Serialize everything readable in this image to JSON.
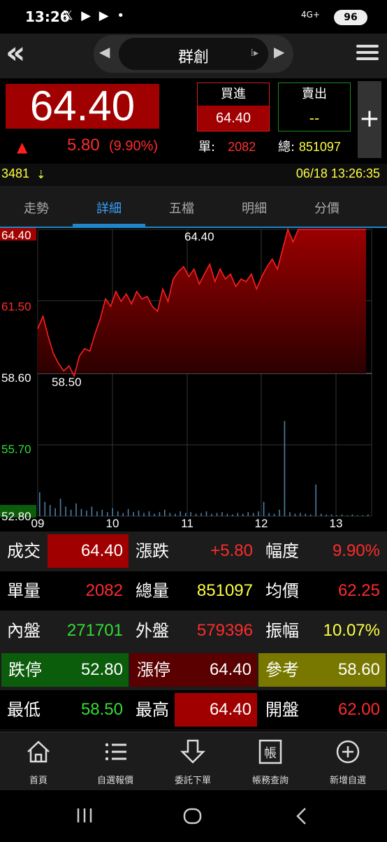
{
  "status": {
    "time": "13:26",
    "network": "4G+",
    "battery": "96",
    "apps": "𝕏 ▶ ▶ •"
  },
  "header": {
    "stock_name": "群創"
  },
  "quote": {
    "price": "64.40",
    "change": "5.80",
    "change_pct": "(9.90%)",
    "buy_label": "買進",
    "buy_value": "64.40",
    "sell_label": "賣出",
    "sell_value": "--",
    "single_label": "單:",
    "single_value": "2082",
    "total_label": "總:",
    "total_value": "851097"
  },
  "info": {
    "code": "3481",
    "datetime": "06/18 13:26:35"
  },
  "tabs": [
    "走勢",
    "詳細",
    "五檔",
    "明細",
    "分價"
  ],
  "chart_data": {
    "type": "area",
    "y_ticks": [
      "64.40",
      "61.50",
      "58.60",
      "55.70",
      "52.80"
    ],
    "x_ticks": [
      "09",
      "10",
      "11",
      "12",
      "13"
    ],
    "price_high_label": "64.40",
    "price_low_label": "58.50",
    "ylim": [
      52.8,
      64.4
    ],
    "series": [
      {
        "values": [
          60.4,
          60.9,
          60.1,
          59.4,
          59.0,
          58.7,
          58.9,
          58.5,
          59.3,
          59.6,
          59.5,
          60.2,
          60.8,
          61.6,
          61.3,
          61.9,
          61.5,
          61.8,
          61.4,
          61.9,
          61.6,
          61.7,
          61.3,
          61.1,
          62.0,
          61.5,
          62.4,
          62.7,
          62.9,
          62.5,
          62.8,
          62.2,
          62.6,
          63.0,
          62.3,
          62.8,
          62.4,
          62.6,
          62.1,
          62.4,
          62.3,
          62.6,
          62.0,
          62.5,
          62.9,
          63.2,
          62.8,
          63.6,
          64.4,
          63.9,
          64.4,
          64.4,
          64.4,
          64.4,
          64.4,
          64.4,
          64.4,
          64.4,
          64.4,
          64.4,
          64.4,
          64.4,
          64.4,
          64.4
        ]
      }
    ],
    "volume": [
      30,
      18,
      14,
      10,
      22,
      12,
      8,
      16,
      9,
      7,
      12,
      6,
      8,
      5,
      10,
      6,
      4,
      9,
      5,
      7,
      4,
      6,
      3,
      5,
      8,
      4,
      3,
      6,
      4,
      5,
      3,
      4,
      6,
      3,
      4,
      5,
      3,
      2,
      4,
      3,
      5,
      4,
      6,
      18,
      4,
      3,
      8,
      120,
      5,
      3,
      4,
      3,
      2,
      40,
      3,
      2,
      2,
      1,
      2,
      1,
      2,
      1,
      1,
      2
    ]
  },
  "stats": {
    "r1": [
      {
        "label": "成交",
        "value": "64.40"
      },
      {
        "label": "漲跌",
        "value": "+5.80"
      },
      {
        "label": "幅度",
        "value": "9.90%"
      }
    ],
    "r2": [
      {
        "label": "單量",
        "value": "2082"
      },
      {
        "label": "總量",
        "value": "851097"
      },
      {
        "label": "均價",
        "value": "62.25"
      }
    ],
    "r3": [
      {
        "label": "內盤",
        "value": "271701"
      },
      {
        "label": "外盤",
        "value": "579396"
      },
      {
        "label": "振幅",
        "value": "10.07%"
      }
    ],
    "r4": [
      {
        "label": "跌停",
        "value": "52.80"
      },
      {
        "label": "漲停",
        "value": "64.40"
      },
      {
        "label": "參考",
        "value": "58.60"
      }
    ],
    "r5": [
      {
        "label": "最低",
        "value": "58.50"
      },
      {
        "label": "最高",
        "value": "64.40"
      },
      {
        "label": "開盤",
        "value": "62.00"
      }
    ]
  },
  "bottom_nav": [
    "首頁",
    "自選報價",
    "委託下單",
    "帳務查詢",
    "新增自選"
  ],
  "colors": {
    "up": "#ff2b2b",
    "down": "#33dd33",
    "neutral": "#ffff44",
    "accent": "#1f86c9"
  }
}
